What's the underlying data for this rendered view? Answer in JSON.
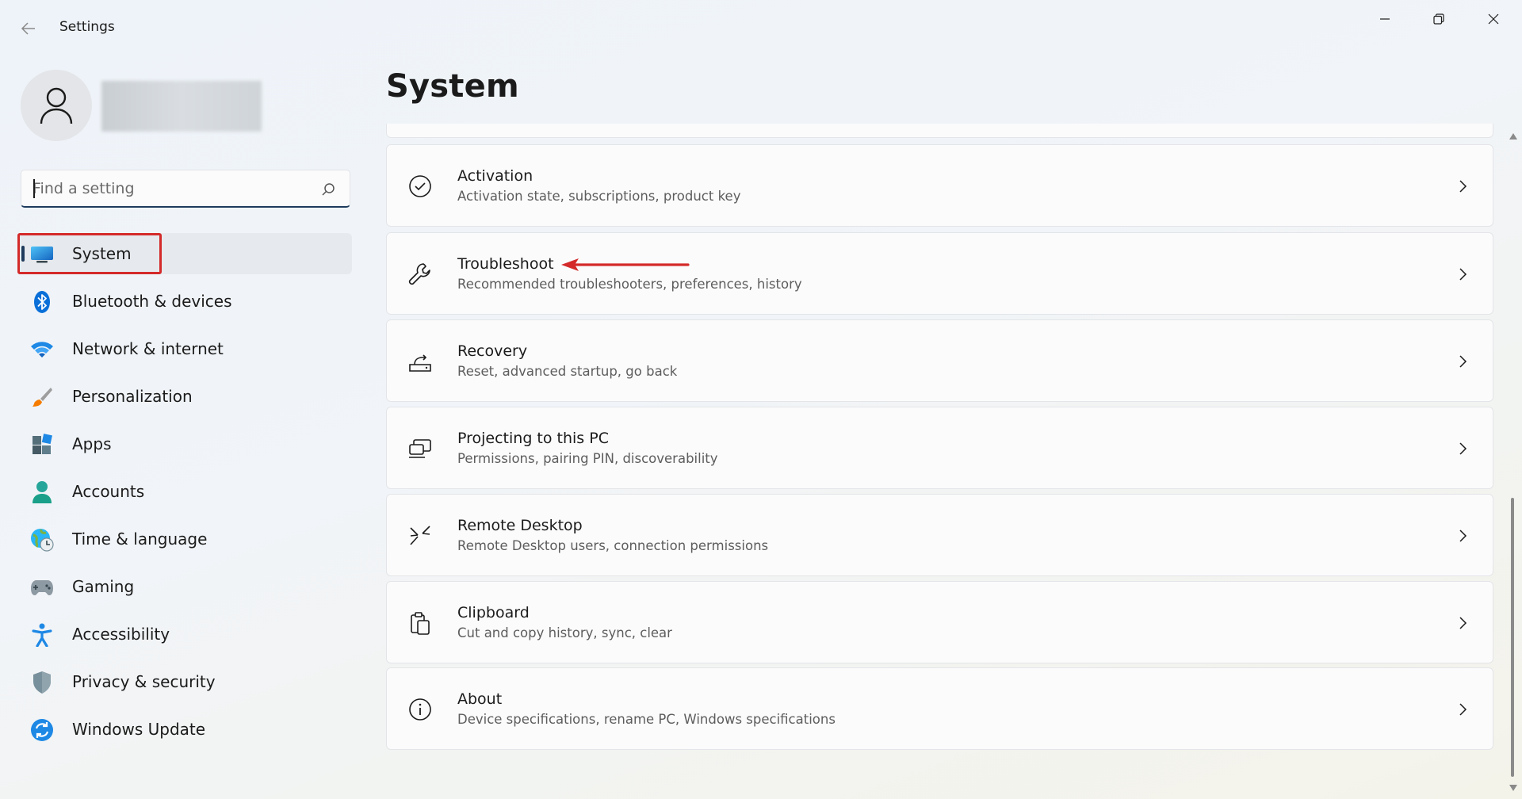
{
  "window": {
    "title": "Settings",
    "controls": [
      "minimize-icon",
      "maximize-icon",
      "close-icon"
    ]
  },
  "search": {
    "placeholder": "Find a setting",
    "value": ""
  },
  "sidebar": {
    "items": [
      {
        "label": "System",
        "icon": "system-icon",
        "active": true,
        "highlighted": true
      },
      {
        "label": "Bluetooth & devices",
        "icon": "bluetooth-icon"
      },
      {
        "label": "Network & internet",
        "icon": "wifi-icon"
      },
      {
        "label": "Personalization",
        "icon": "paintbrush-icon"
      },
      {
        "label": "Apps",
        "icon": "apps-icon"
      },
      {
        "label": "Accounts",
        "icon": "accounts-icon"
      },
      {
        "label": "Time & language",
        "icon": "globe-clock-icon"
      },
      {
        "label": "Gaming",
        "icon": "gamepad-icon"
      },
      {
        "label": "Accessibility",
        "icon": "accessibility-icon"
      },
      {
        "label": "Privacy & security",
        "icon": "shield-icon"
      },
      {
        "label": "Windows Update",
        "icon": "sync-icon"
      }
    ]
  },
  "main": {
    "title": "System",
    "cards": [
      {
        "title": "Activation",
        "subtitle": "Activation state, subscriptions, product key",
        "icon": "check-circle-icon"
      },
      {
        "title": "Troubleshoot",
        "subtitle": "Recommended troubleshooters, preferences, history",
        "icon": "wrench-icon",
        "annotated": true
      },
      {
        "title": "Recovery",
        "subtitle": "Reset, advanced startup, go back",
        "icon": "recovery-icon"
      },
      {
        "title": "Projecting to this PC",
        "subtitle": "Permissions, pairing PIN, discoverability",
        "icon": "projecting-icon"
      },
      {
        "title": "Remote Desktop",
        "subtitle": "Remote Desktop users, connection permissions",
        "icon": "remote-desktop-icon"
      },
      {
        "title": "Clipboard",
        "subtitle": "Cut and copy history, sync, clear",
        "icon": "clipboard-icon"
      },
      {
        "title": "About",
        "subtitle": "Device specifications, rename PC, Windows specifications",
        "icon": "info-icon"
      }
    ]
  },
  "colors": {
    "accent": "#1f3b5c",
    "annotation_red": "#d42a2a",
    "bluetooth_blue": "#0a6fd8",
    "accounts_teal": "#1aa08a"
  }
}
